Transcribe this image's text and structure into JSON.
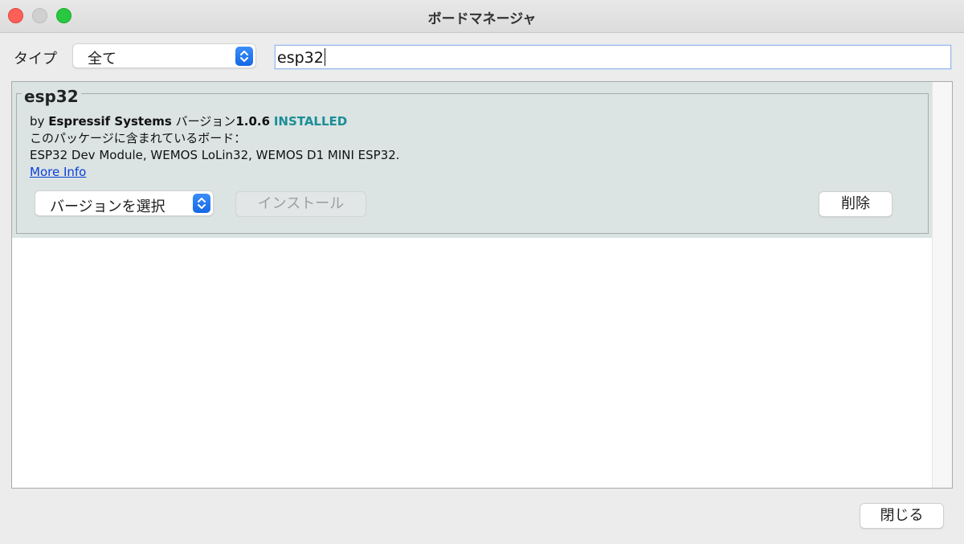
{
  "window": {
    "title": "ボードマネージャ"
  },
  "filter": {
    "type_label": "タイプ",
    "type_value": "全て",
    "search_value": "esp32"
  },
  "package": {
    "name": "esp32",
    "by_prefix": "by",
    "author": "Espressif Systems",
    "version_label": "バージョン",
    "version": "1.0.6",
    "status": "INSTALLED",
    "boards_label": "このパッケージに含まれているボード：",
    "boards": "ESP32 Dev Module, WEMOS LoLin32, WEMOS D1 MINI ESP32.",
    "more_info": "More Info"
  },
  "actions": {
    "version_select": "バージョンを選択",
    "install": "インストール",
    "remove": "削除",
    "close": "閉じる"
  },
  "colors": {
    "installed": "#1b8e96",
    "link": "#0b3fd8",
    "accent": "#1468e6"
  },
  "icons": [
    "close-window-icon",
    "minimize-window-icon",
    "maximize-window-icon",
    "updown-chevron-icon"
  ]
}
